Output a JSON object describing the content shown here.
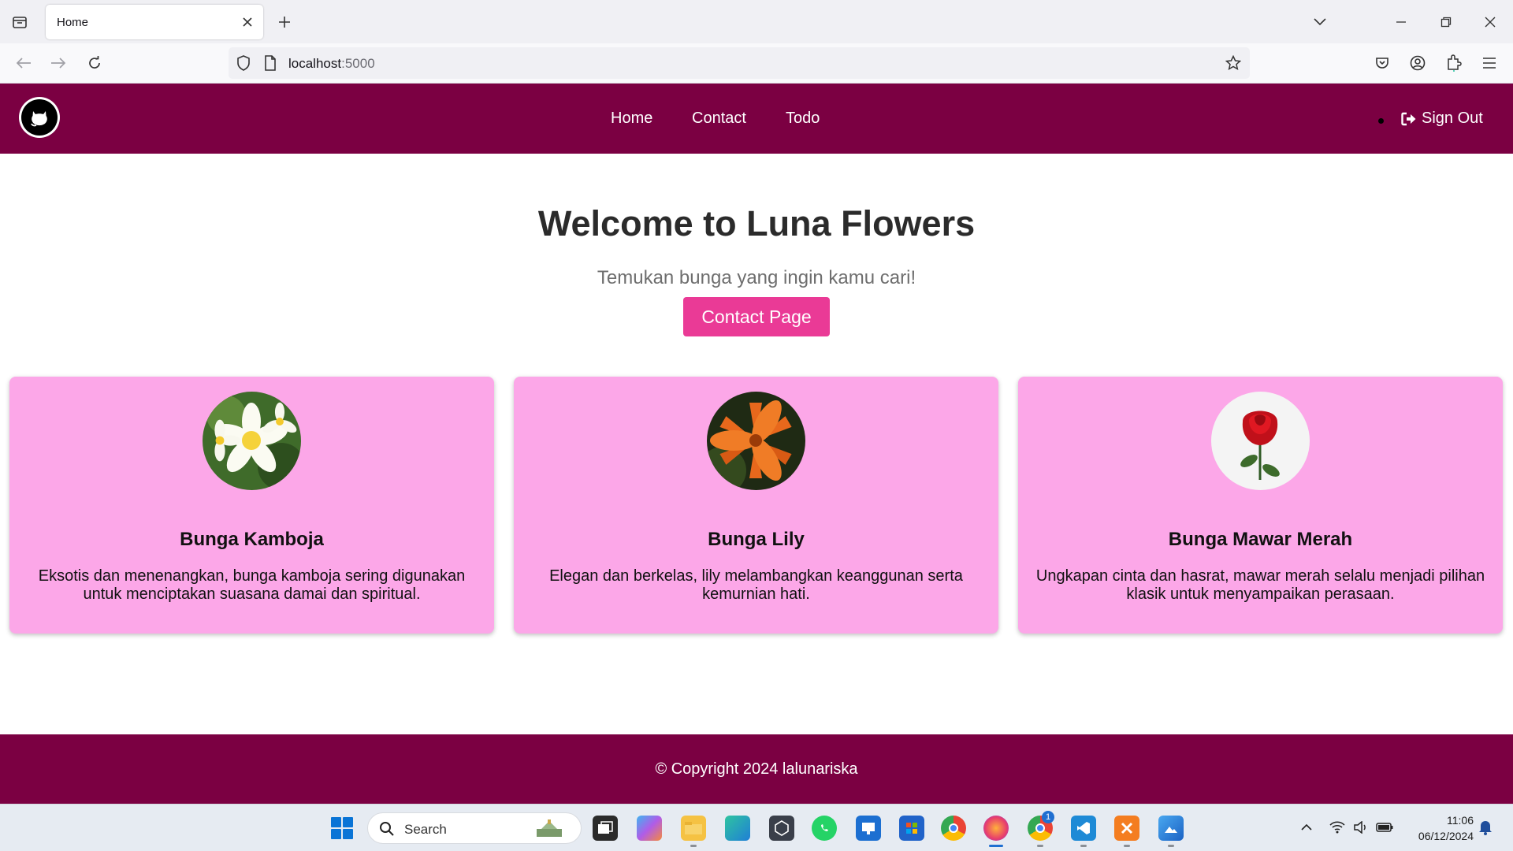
{
  "browser": {
    "tab_title": "Home",
    "url_host": "localhost",
    "url_port": ":5000"
  },
  "site": {
    "nav": [
      "Home",
      "Contact",
      "Todo"
    ],
    "signout_label": "Sign Out",
    "hero_title": "Welcome to Luna Flowers",
    "hero_subtitle": "Temukan bunga yang ingin kamu cari!",
    "hero_button": "Contact Page",
    "cards": [
      {
        "title": "Bunga Kamboja",
        "description": "Eksotis dan menenangkan, bunga kamboja sering digunakan untuk menciptakan suasana damai dan spiritual.",
        "image_icon": "frangipani-flower-image"
      },
      {
        "title": "Bunga Lily",
        "description": "Elegan dan berkelas, lily melambangkan keanggunan serta kemurnian hati.",
        "image_icon": "orange-lily-flower-image"
      },
      {
        "title": "Bunga Mawar Merah",
        "description": "Ungkapan cinta dan hasrat, mawar merah selalu menjadi pilihan klasik untuk menyampaikan perasaan.",
        "image_icon": "red-rose-flower-image"
      }
    ],
    "footer": "© Copyright 2024 lalunariska"
  },
  "taskbar": {
    "search_placeholder": "Search",
    "time": "11:06",
    "date": "06/12/2024",
    "badge_count": "1"
  },
  "colors": {
    "header_bg": "#7b0042",
    "card_bg": "#fca7e8",
    "button_bg": "#ea3a96"
  }
}
